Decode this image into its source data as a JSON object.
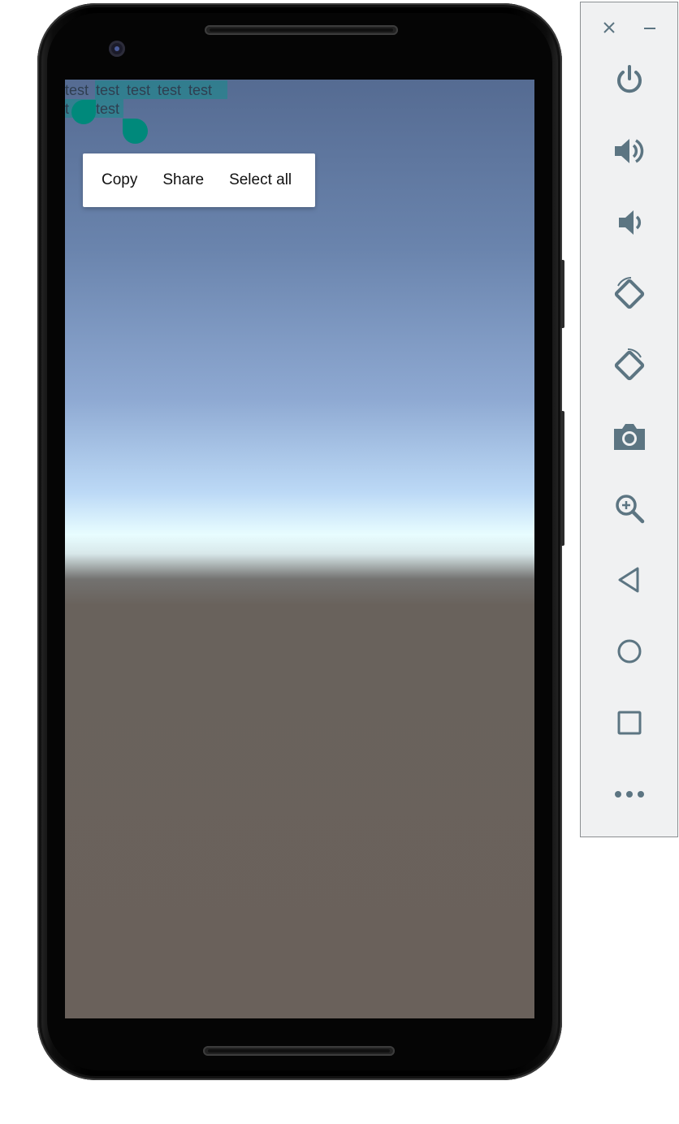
{
  "device": {
    "screen_text_lines": [
      [
        "test",
        "test",
        "test",
        "test",
        "test"
      ],
      [
        "t",
        "test"
      ]
    ],
    "selection_color": "#009688",
    "handle_color": "#00897b"
  },
  "context_menu": {
    "copy_label": "Copy",
    "share_label": "Share",
    "select_all_label": "Select all"
  },
  "emulator_toolbar": {
    "accent_color": "#5c7582",
    "window_controls": [
      "close-icon",
      "minimize-icon"
    ],
    "buttons": [
      "power-icon",
      "volume-up-icon",
      "volume-down-icon",
      "rotate-left-icon",
      "rotate-right-icon",
      "camera-icon",
      "zoom-icon",
      "back-icon",
      "home-icon",
      "overview-icon",
      "more-icon"
    ]
  }
}
